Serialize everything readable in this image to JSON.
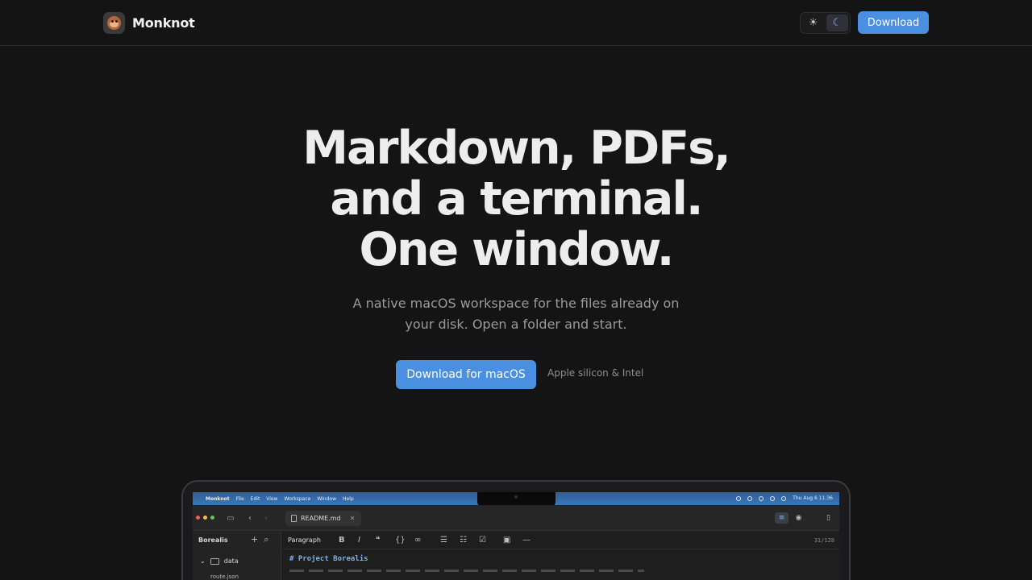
{
  "header": {
    "brand_name": "Monknot",
    "download_label": "Download",
    "theme": {
      "light_icon": "sun-icon",
      "dark_icon": "moon-icon",
      "active": "dark"
    }
  },
  "hero": {
    "title_line1": "Markdown, PDFs,",
    "title_line2": "and a terminal.",
    "title_line3": "One window.",
    "subtitle": "A native macOS workspace for the files already on your disk. Open a folder and start.",
    "cta_label": "Download for macOS",
    "cta_note": "Apple silicon & Intel"
  },
  "mockup": {
    "menubar": {
      "app": "Monknot",
      "items": [
        "File",
        "Edit",
        "View",
        "Workspace",
        "Window",
        "Help"
      ],
      "clock": "Thu Aug 6  11:36"
    },
    "tab_label": "README.md",
    "sidebar": {
      "workspace": "Borealis",
      "folder": "data",
      "file": "route.json"
    },
    "editor": {
      "block_type": "Paragraph",
      "counter": "31/128",
      "first_line": "# Project Borealis"
    }
  },
  "colors": {
    "accent": "#4a8fe0",
    "background": "#141414"
  }
}
